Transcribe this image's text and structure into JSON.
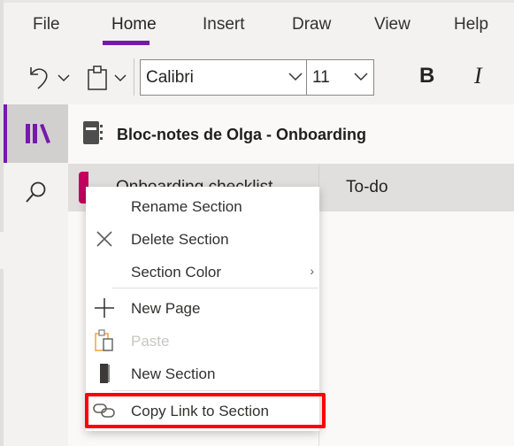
{
  "ribbon": {
    "tabs": [
      {
        "label": "File"
      },
      {
        "label": "Home"
      },
      {
        "label": "Insert"
      },
      {
        "label": "Draw"
      },
      {
        "label": "View"
      },
      {
        "label": "Help"
      }
    ],
    "active_tab": "Home",
    "font_name": "Calibri",
    "font_size": "11",
    "bold_label": "B",
    "italic_label": "I"
  },
  "navigation": {
    "notebook_title": "Bloc-notes de Olga - Onboarding",
    "section_name": "Onboarding checklist",
    "section_color": "#c3005e",
    "page_name": "To-do"
  },
  "context_menu": {
    "items": [
      {
        "label": "Rename Section",
        "icon": "none"
      },
      {
        "label": "Delete Section",
        "icon": "close-icon"
      },
      {
        "label": "Section Color",
        "icon": "none",
        "submenu": "›"
      },
      {
        "label": "New Page",
        "icon": "plus-icon"
      },
      {
        "label": "Paste",
        "icon": "paste-icon",
        "disabled": true
      },
      {
        "label": "New Section",
        "icon": "section-icon"
      },
      {
        "label": "Copy Link to Section",
        "icon": "link-icon",
        "highlighted": true
      }
    ]
  },
  "colors": {
    "accent": "#7719aa",
    "highlight_box": "#ff0000"
  }
}
